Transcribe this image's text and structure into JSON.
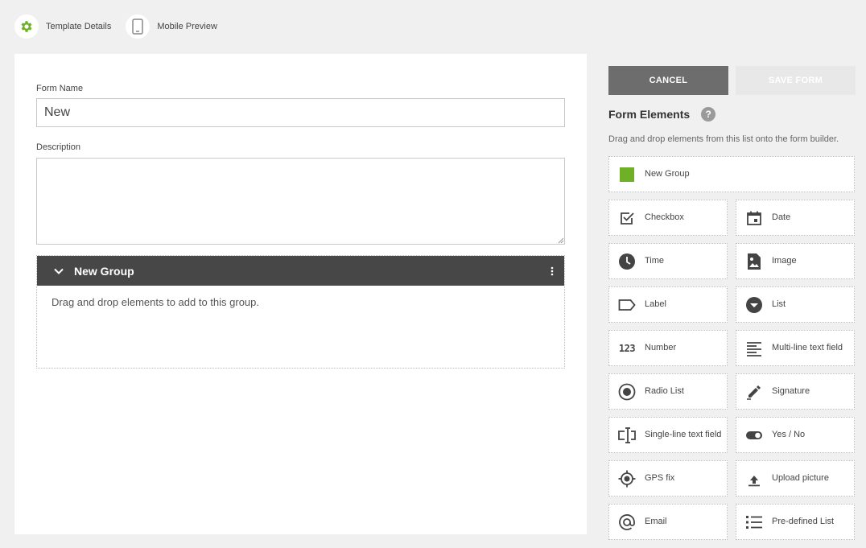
{
  "nav": {
    "template_details": "Template Details",
    "mobile_preview": "Mobile Preview"
  },
  "form": {
    "name_label": "Form Name",
    "name_value": "New",
    "description_label": "Description",
    "description_value": ""
  },
  "group": {
    "title": "New Group",
    "hint": "Drag and drop elements to add to this group."
  },
  "actions": {
    "cancel": "CANCEL",
    "save": "SAVE FORM"
  },
  "elements": {
    "title": "Form Elements",
    "help": "?",
    "description": "Drag and drop elements from this list onto the form builder.",
    "new_group": "New Group",
    "checkbox": "Checkbox",
    "date": "Date",
    "time": "Time",
    "image": "Image",
    "label": "Label",
    "list": "List",
    "number": "Number",
    "number_icon": "123",
    "multiline": "Multi-line text field",
    "radio": "Radio List",
    "signature": "Signature",
    "singleline": "Single-line text field",
    "yesno": "Yes / No",
    "gps": "GPS fix",
    "upload": "Upload picture",
    "email": "Email",
    "predefined": "Pre-defined List"
  },
  "colors": {
    "accent_green": "#6fb026",
    "header_dark": "#474747",
    "cancel_gray": "#6d6d6d",
    "save_disabled": "#e8e8e8"
  }
}
